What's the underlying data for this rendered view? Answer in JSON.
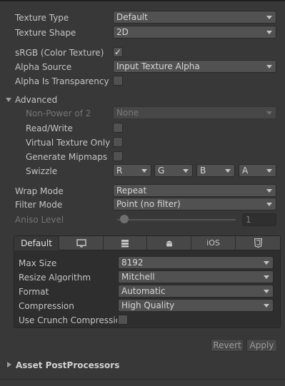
{
  "texture_type": {
    "label": "Texture Type",
    "value": "Default"
  },
  "texture_shape": {
    "label": "Texture Shape",
    "value": "2D"
  },
  "srgb": {
    "label": "sRGB (Color Texture)",
    "checked": true,
    "check_glyph": "✓"
  },
  "alpha_source": {
    "label": "Alpha Source",
    "value": "Input Texture Alpha"
  },
  "alpha_transparency": {
    "label": "Alpha Is Transparency",
    "checked": false
  },
  "advanced": {
    "header": "Advanced",
    "non_power_of_2": {
      "label": "Non-Power of 2",
      "value": "None"
    },
    "read_write": {
      "label": "Read/Write"
    },
    "virtual_texture_only": {
      "label": "Virtual Texture Only"
    },
    "generate_mipmaps": {
      "label": "Generate Mipmaps"
    },
    "swizzle": {
      "label": "Swizzle",
      "channels": [
        "R",
        "G",
        "B",
        "A"
      ]
    }
  },
  "wrap_mode": {
    "label": "Wrap Mode",
    "value": "Repeat"
  },
  "filter_mode": {
    "label": "Filter Mode",
    "value": "Point (no filter)"
  },
  "aniso_level": {
    "label": "Aniso Level",
    "value": "1"
  },
  "platform_tabs": {
    "default_label": "Default",
    "icons": [
      "monitor-icon",
      "server-icon",
      "android-icon",
      "ios-icon",
      "html5-icon"
    ],
    "ios_label": "iOS"
  },
  "platform_settings": {
    "max_size": {
      "label": "Max Size",
      "value": "8192"
    },
    "resize_algorithm": {
      "label": "Resize Algorithm",
      "value": "Mitchell"
    },
    "format": {
      "label": "Format",
      "value": "Automatic"
    },
    "compression": {
      "label": "Compression",
      "value": "High Quality"
    },
    "use_crunch": {
      "label": "Use Crunch Compressio"
    }
  },
  "buttons": {
    "revert": "Revert",
    "apply": "Apply"
  },
  "asset_postprocessors": {
    "header": "Asset PostProcessors"
  }
}
